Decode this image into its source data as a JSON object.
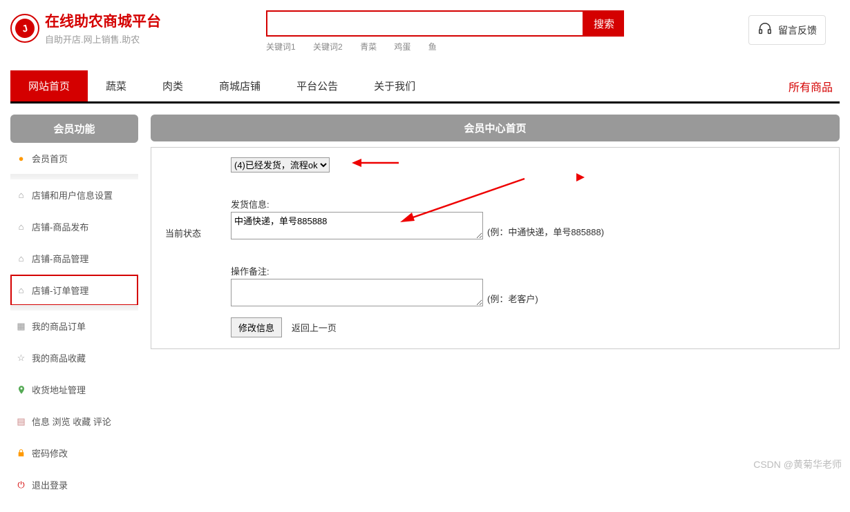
{
  "header": {
    "brand_title": "在线助农商城平台",
    "brand_sub": "自助开店.网上销售.助农",
    "search_placeholder": "",
    "search_btn": "搜索",
    "keywords": [
      "关键词1",
      "关键词2",
      "青菜",
      "鸡蛋",
      "鱼"
    ],
    "feedback": "留言反馈"
  },
  "nav": {
    "items": [
      "网站首页",
      "蔬菜",
      "肉类",
      "商城店铺",
      "平台公告",
      "关于我们"
    ],
    "right": "所有商品"
  },
  "sidebar": {
    "head": "会员功能",
    "items": [
      {
        "label": "会员首页",
        "icon": "home",
        "color": "orange"
      },
      {
        "label": "店铺和用户信息设置",
        "icon": "house"
      },
      {
        "label": "店铺-商品发布",
        "icon": "house"
      },
      {
        "label": "店铺-商品管理",
        "icon": "house"
      },
      {
        "label": "店铺-订单管理",
        "icon": "house",
        "selected": true
      },
      {
        "label": "我的商品订单",
        "icon": "grid"
      },
      {
        "label": "我的商品收藏",
        "icon": "star"
      },
      {
        "label": "收货地址管理",
        "icon": "pin",
        "color": "green"
      },
      {
        "label": "信息 浏览 收藏 评论",
        "icon": "doc",
        "color": "tan"
      },
      {
        "label": "密码修改",
        "icon": "lock",
        "color": "orange"
      },
      {
        "label": "退出登录",
        "icon": "power",
        "color": "red"
      }
    ]
  },
  "panel": {
    "head": "会员中心首页",
    "status_label": "当前状态",
    "status_options": [
      "(4)已经发货，流程ok"
    ],
    "ship_label": "发货信息:",
    "ship_value": "中通快递，单号885888",
    "ship_hint": "(例：中通快递，单号885888)",
    "note_label": "操作备注:",
    "note_value": "",
    "note_hint": "(例：老客户)",
    "submit": "修改信息",
    "back": "返回上一页"
  },
  "watermark": "CSDN @黄菊华老师"
}
